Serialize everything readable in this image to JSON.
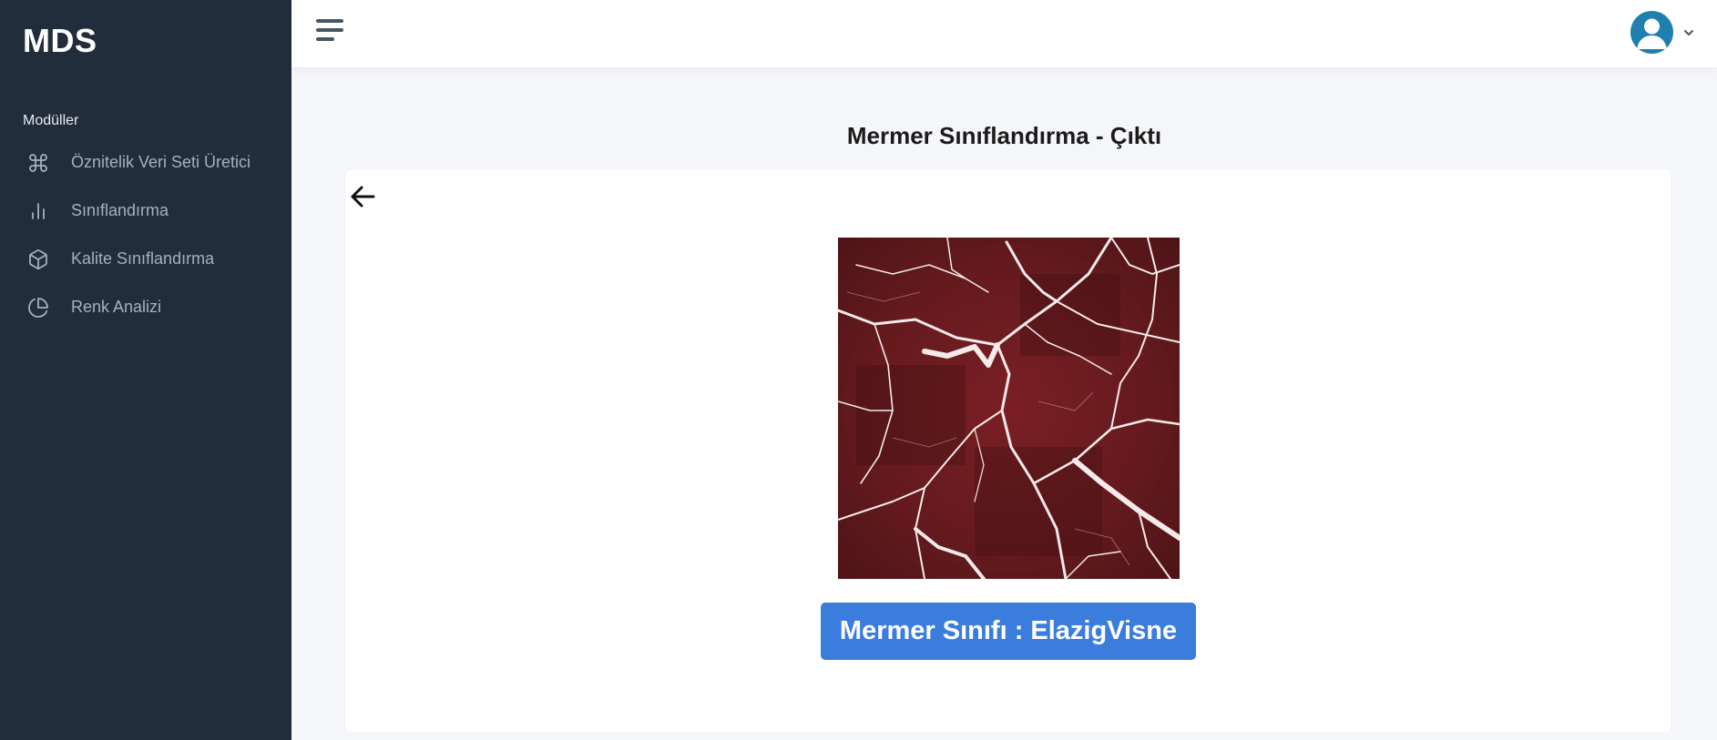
{
  "app": {
    "brand": "MDS"
  },
  "sidebar": {
    "section_label": "Modüller",
    "items": [
      {
        "label": "Öznitelik Veri Seti Üretici",
        "icon": "command-icon"
      },
      {
        "label": "Sınıflandırma",
        "icon": "bar-chart-icon"
      },
      {
        "label": "Kalite Sınıflandırma",
        "icon": "box-icon"
      },
      {
        "label": "Renk Analizi",
        "icon": "pie-chart-icon"
      }
    ]
  },
  "header": {
    "menu_icon": "hamburger-icon",
    "user_icon": "user-avatar-icon",
    "dropdown_icon": "chevron-down-icon"
  },
  "main": {
    "title": "Mermer Sınıflandırma - Çıktı",
    "back_icon": "arrow-left-icon",
    "result_label": "Mermer Sınıfı : ElazigVisne"
  },
  "colors": {
    "sidebar_bg": "#222d3b",
    "accent": "#3b7ddd",
    "avatar": "#1f7fae",
    "marble_base": "#6b1a1d"
  }
}
